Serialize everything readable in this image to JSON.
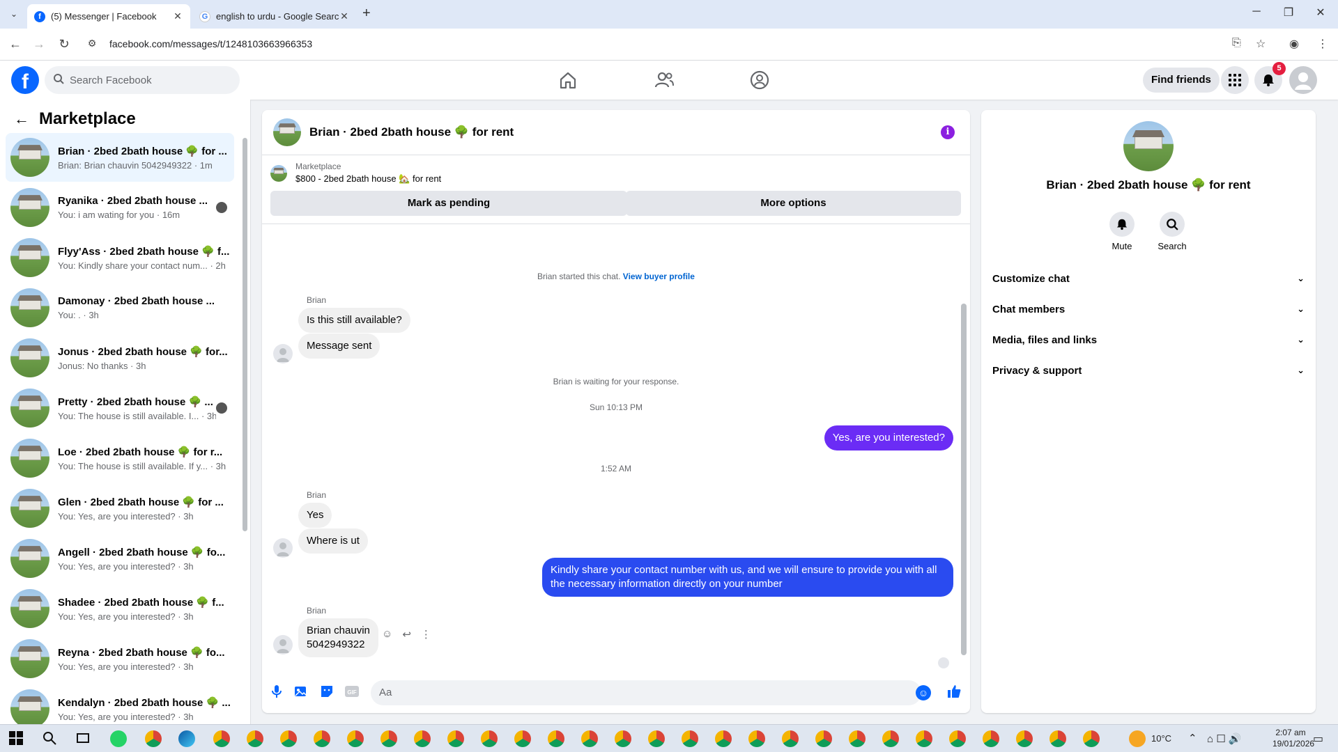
{
  "browser": {
    "tabs": [
      {
        "title": "(5) Messenger | Facebook",
        "active": true
      },
      {
        "title": "english to urdu - Google Search",
        "active": false
      }
    ],
    "url": "facebook.com/messages/t/1248103663966353"
  },
  "fb_header": {
    "logo": "f",
    "search_placeholder": "Search Facebook",
    "find_friends": "Find friends",
    "notification_count": "5"
  },
  "sidebar": {
    "title": "Marketplace",
    "conversations": [
      {
        "name": "Brian · 2bed 2bath house 🌳 for ...",
        "preview": "Brian: Brian chauvin 5042949322 · 1m",
        "active": true,
        "mini_avatar": false
      },
      {
        "name": "Ryanika · 2bed 2bath house ...",
        "preview": "You: i am wating for you · 16m",
        "active": false,
        "mini_avatar": true
      },
      {
        "name": "Flyy'Ass · 2bed 2bath house 🌳 f...",
        "preview": "You: Kindly share your contact num... · 2h",
        "active": false,
        "mini_avatar": false
      },
      {
        "name": "Damonay · 2bed 2bath house ...",
        "preview": "You: . · 3h",
        "active": false,
        "mini_avatar": false
      },
      {
        "name": "Jonus · 2bed 2bath house 🌳 for...",
        "preview": "Jonus: No thanks · 3h",
        "active": false,
        "mini_avatar": false
      },
      {
        "name": "Pretty · 2bed 2bath house 🌳 ...",
        "preview": "You: The house is still available. I... · 3h",
        "active": false,
        "mini_avatar": true
      },
      {
        "name": "Loe · 2bed 2bath house 🌳 for r...",
        "preview": "You: The house is still available. If y... · 3h",
        "active": false,
        "mini_avatar": false
      },
      {
        "name": "Glen · 2bed 2bath house 🌳 for ...",
        "preview": "You: Yes, are you interested? · 3h",
        "active": false,
        "mini_avatar": false
      },
      {
        "name": "Angell · 2bed 2bath house 🌳 fo...",
        "preview": "You: Yes, are you interested? · 3h",
        "active": false,
        "mini_avatar": false
      },
      {
        "name": "Shadee · 2bed 2bath house 🌳 f...",
        "preview": "You: Yes, are you interested? · 3h",
        "active": false,
        "mini_avatar": false
      },
      {
        "name": "Reyna · 2bed 2bath house 🌳 fo...",
        "preview": "You: Yes, are you interested? · 3h",
        "active": false,
        "mini_avatar": false
      },
      {
        "name": "Kendalyn · 2bed 2bath house 🌳 ...",
        "preview": "You: Yes, are you interested? · 3h",
        "active": false,
        "mini_avatar": false
      }
    ]
  },
  "chat": {
    "title": "Brian · 2bed 2bath house 🌳 for rent",
    "listing_source": "Marketplace",
    "listing_title": "$800 - 2bed 2bath house 🏡 for rent",
    "mark_pending": "Mark as pending",
    "more_options": "More options",
    "started_text": "Brian started this chat.",
    "view_buyer_profile": "View buyer profile",
    "sender_name": "Brian",
    "msg1": "Is this still available?",
    "msg2": "Message sent",
    "waiting_text": "Brian is waiting for your response.",
    "time1": "Sun 10:13 PM",
    "out1": "Yes, are you interested?",
    "time2": "1:52 AM",
    "msg3": "Yes",
    "msg4": "Where is ut",
    "out2_line1": "Kindly share your contact number with us, and we will ensure to provide you with all",
    "out2_line2": "the necessary information directly on your number",
    "msg5_line1": "Brian chauvin",
    "msg5_line2": "5042949322",
    "composer_placeholder": "Aa"
  },
  "info_panel": {
    "name": "Brian · 2bed 2bath house 🌳 for rent",
    "mute": "Mute",
    "search": "Search",
    "sections": [
      "Customize chat",
      "Chat members",
      "Media, files and links",
      "Privacy & support"
    ]
  },
  "taskbar": {
    "temperature": "10°C",
    "time": "2:07 am",
    "date": "19/01/2026"
  },
  "colors": {
    "fb_blue": "#0866ff",
    "out_bubble_purple": "#6b2cf5",
    "out_bubble_blue": "#2a4bf0",
    "notification_red": "#e41e3f"
  }
}
